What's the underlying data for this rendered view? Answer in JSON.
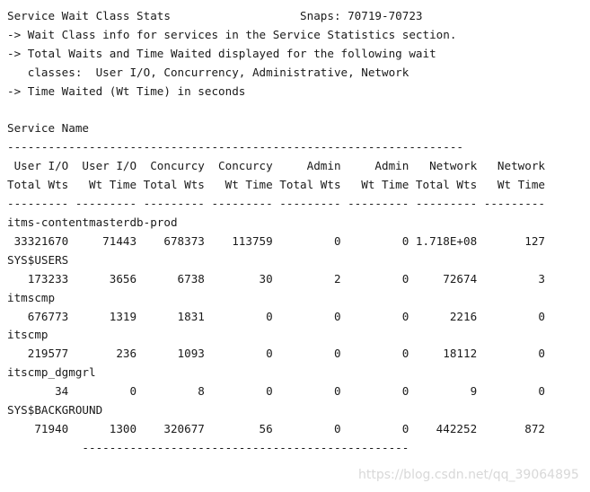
{
  "report": {
    "title": "Service Wait Class Stats",
    "snaps_label": "Snaps: 70719-70723",
    "notes": [
      "-> Wait Class info for services in the Service Statistics section.",
      "-> Total Waits and Time Waited displayed for the following wait",
      "   classes:  User I/O, Concurrency, Administrative, Network",
      "-> Time Waited (Wt Time) in seconds"
    ],
    "service_name_header": "Service Name",
    "service_name_rule": "-------------------------------------------------------------",
    "column_headers_line1": " User I/O  User I/O  Concurcy  Concurcy     Admin     Admin   Network   Network",
    "column_headers_line2": "Total Wts   Wt Time Total Wts   Wt Time Total Wts   Wt Time Total Wts   Wt Time",
    "column_rule": "--------- --------- --------- --------- --------- --------- --------- ---------",
    "bottom_rule": "          -------------------------------------------------",
    "columns": [
      "User I/O Total Wts",
      "User I/O Wt Time",
      "Concurcy Total Wts",
      "Concurcy Wt Time",
      "Admin Total Wts",
      "Admin Wt Time",
      "Network Total Wts",
      "Network Wt Time"
    ],
    "rows": [
      {
        "service": "itms-contentmasterdb-prod",
        "values": [
          "33321670",
          "71443",
          "678373",
          "113759",
          "0",
          "0",
          "1.718E+08",
          "127"
        ],
        "values_line": " 33321670     71443    678373    113759         0         0 1.718E+08       127"
      },
      {
        "service": "SYS$USERS",
        "values": [
          "173233",
          "3656",
          "6738",
          "30",
          "2",
          "0",
          "72674",
          "3"
        ],
        "values_line": "   173233      3656      6738        30         2         0     72674         3"
      },
      {
        "service": "itmscmp",
        "values": [
          "676773",
          "1319",
          "1831",
          "0",
          "0",
          "0",
          "2216",
          "0"
        ],
        "values_line": "   676773      1319      1831         0         0         0      2216         0"
      },
      {
        "service": "itscmp",
        "values": [
          "219577",
          "236",
          "1093",
          "0",
          "0",
          "0",
          "18112",
          "0"
        ],
        "values_line": "   219577       236      1093         0         0         0     18112         0"
      },
      {
        "service": "itscmp_dgmgrl",
        "values": [
          "34",
          "0",
          "8",
          "0",
          "0",
          "0",
          "9",
          "0"
        ],
        "values_line": "       34         0         8         0         0         0         9         0"
      },
      {
        "service": "SYS$BACKGROUND",
        "values": [
          "71940",
          "1300",
          "320677",
          "56",
          "0",
          "0",
          "442252",
          "872"
        ],
        "values_line": "    71940      1300    320677        56         0         0    442252       872"
      }
    ],
    "full_text": "Service Wait Class Stats                   Snaps: 70719-70723\n-> Wait Class info for services in the Service Statistics section.\n-> Total Waits and Time Waited displayed for the following wait\n   classes:  User I/O, Concurrency, Administrative, Network\n-> Time Waited (Wt Time) in seconds\n\nService Name\n-------------------------------------------------------------------\n User I/O  User I/O  Concurcy  Concurcy     Admin     Admin   Network   Network\nTotal Wts   Wt Time Total Wts   Wt Time Total Wts   Wt Time Total Wts   Wt Time\n--------- --------- --------- --------- --------- --------- --------- ---------\nitms-contentmasterdb-prod\n 33321670     71443    678373    113759         0         0 1.718E+08       127\nSYS$USERS\n   173233      3656      6738        30         2         0     72674         3\nitmscmp\n   676773      1319      1831         0         0         0      2216         0\nitscmp\n   219577       236      1093         0         0         0     18112         0\nitscmp_dgmgrl\n       34         0         8         0         0         0         9         0\nSYS$BACKGROUND\n    71940      1300    320677        56         0         0    442252       872\n           ------------------------------------------------"
  },
  "watermark": {
    "text": "https://blog.csdn.net/qq_39064895",
    "color": "#d8d8d8"
  }
}
